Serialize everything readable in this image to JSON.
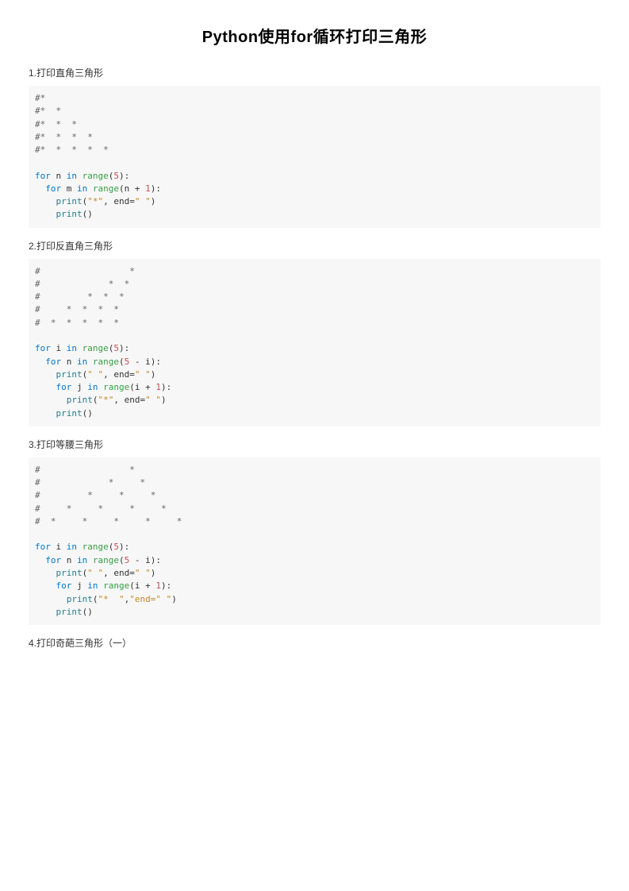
{
  "title": "Python使用for循环打印三角形",
  "sections": {
    "s1": {
      "label": "1.打印直角三角形"
    },
    "s2": {
      "label": "2.打印反直角三角形"
    },
    "s3": {
      "label": "3.打印等腰三角形"
    },
    "s4": {
      "label": "4.打印奇葩三角形（一）"
    }
  },
  "code1": {
    "comment_lines": [
      "#* ",
      "#*  * ",
      "#*  *  * ",
      "#*  *  *  * ",
      "#*  *  *  *  * "
    ],
    "l1_for": "for",
    "l1_var": "n",
    "l1_in": "in",
    "l1_range": "range",
    "l1_op1": "(",
    "l1_num": "5",
    "l1_op2": "):",
    "l2_for": "for",
    "l2_var": "m",
    "l2_in": "in",
    "l2_range": "range",
    "l2_op1": "(n + ",
    "l2_num": "1",
    "l2_op2": "):",
    "l3_print": "print",
    "l3_op1": "(",
    "l3_str": "\"*\"",
    "l3_mid": ", end=",
    "l3_str2": "\" \"",
    "l3_op2": ")",
    "l4_print": "print",
    "l4_op": "()"
  },
  "code2": {
    "comment_lines": [
      "#                 * ",
      "#             *  * ",
      "#         *  *  * ",
      "#     *  *  *  * ",
      "#  *  *  *  *  * "
    ],
    "l1_for": "for",
    "l1_var": "i",
    "l1_in": "in",
    "l1_range": "range",
    "l1_op1": "(",
    "l1_num": "5",
    "l1_op2": "):",
    "l2_for": "for",
    "l2_var": "n",
    "l2_in": "in",
    "l2_range": "range",
    "l2_op1": "(",
    "l2_num": "5",
    "l2_mid": " - i",
    "l2_op2": "):",
    "l3_print": "print",
    "l3_op1": "(",
    "l3_str": "\" \"",
    "l3_mid": ", end=",
    "l3_str2": "\" \"",
    "l3_op2": ")",
    "l4_for": "for",
    "l4_var": "j",
    "l4_in": "in",
    "l4_range": "range",
    "l4_op1": "(i + ",
    "l4_num": "1",
    "l4_op2": "):",
    "l5_print": "print",
    "l5_op1": "(",
    "l5_str": "\"*\"",
    "l5_mid": ", end=",
    "l5_str2": "\" \"",
    "l5_op2": ")",
    "l6_print": "print",
    "l6_op": "()"
  },
  "code3": {
    "comment_lines": [
      "#                 * ",
      "#             *     * ",
      "#         *     *     * ",
      "#     *     *     *     * ",
      "#  *     *     *     *     * "
    ],
    "l1_for": "for",
    "l1_var": "i",
    "l1_in": "in",
    "l1_range": "range",
    "l1_op1": "(",
    "l1_num": "5",
    "l1_op2": "):",
    "l2_for": "for",
    "l2_var": "n",
    "l2_in": "in",
    "l2_range": "range",
    "l2_op1": "(",
    "l2_num": "5",
    "l2_mid": " - i",
    "l2_op2": "):",
    "l3_print": "print",
    "l3_op1": "(",
    "l3_str": "\" \"",
    "l3_mid": ", end=",
    "l3_str2": "\" \"",
    "l3_op2": ")",
    "l4_for": "for",
    "l4_var": "j",
    "l4_in": "in",
    "l4_range": "range",
    "l4_op1": "(i + ",
    "l4_num": "1",
    "l4_op2": "):",
    "l5_print": "print",
    "l5_op1": "(",
    "l5_str": "\"*  \"",
    "l5_mid": ",",
    "l5_str2": "\"end=\" \"",
    "l5_op2": ")",
    "l6_print": "print",
    "l6_op": "()"
  }
}
